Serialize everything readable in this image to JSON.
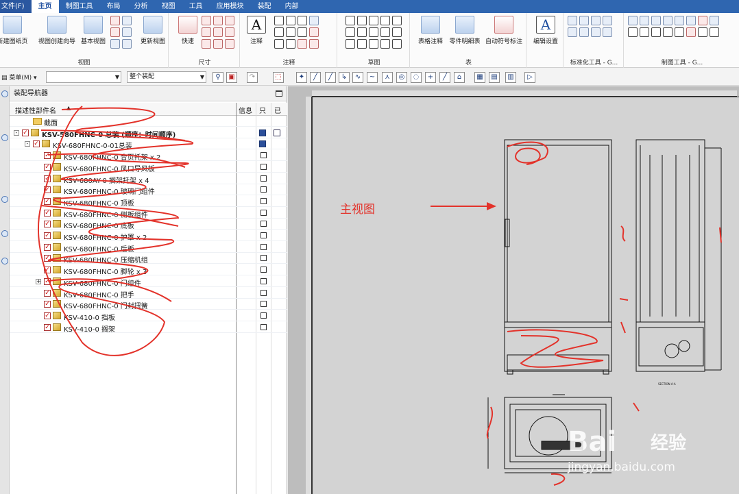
{
  "menu": {
    "file": "文件(F)",
    "tabs": [
      "主页",
      "制图工具",
      "布局",
      "分析",
      "视图",
      "工具",
      "应用模块",
      "装配",
      "内部"
    ]
  },
  "ribbon": {
    "groups": [
      {
        "label": "视图",
        "buttons": [
          "新建图纸页",
          "视图创建向导",
          "基本视图",
          "更新视图"
        ]
      },
      {
        "label": "尺寸",
        "buttons": [
          "快速"
        ]
      },
      {
        "label": "注释",
        "buttons": [
          "注释"
        ]
      },
      {
        "label": "草图",
        "buttons": []
      },
      {
        "label": "表",
        "buttons": [
          "表格注释",
          "零件明细表",
          "自动符号标注"
        ]
      },
      {
        "label": "",
        "buttons": [
          "编辑设置"
        ]
      },
      {
        "label": "标准化工具 - G...",
        "buttons": []
      },
      {
        "label": "制图工具 - G...",
        "buttons": []
      }
    ]
  },
  "toolbar": {
    "menu_label": "菜单(M)",
    "combo1": "",
    "combo2": "整个装配"
  },
  "navigator": {
    "title": "装配导航器",
    "columns": [
      "描述性部件名",
      "信息",
      "只",
      "已"
    ],
    "rows": [
      {
        "indent": 1,
        "type": "folder",
        "label": "截面"
      },
      {
        "indent": 0,
        "type": "assembly",
        "label": "KSV-580FHNC-0 总装 (顺序：时间顺序)",
        "bold": true,
        "expander": "-"
      },
      {
        "indent": 1,
        "type": "assembly",
        "label": "KSV-680FHNC-0-01总装",
        "expander": "-"
      },
      {
        "indent": 2,
        "type": "part",
        "label": "KSV-680FHNC-0 合页托架 x 2"
      },
      {
        "indent": 2,
        "type": "part",
        "label": "KSV-680FHNC-0 风口导风板"
      },
      {
        "indent": 2,
        "type": "part",
        "label": "KSV-680AY-0 搁架托架 x 4"
      },
      {
        "indent": 2,
        "type": "part",
        "label": "KSV-680FHNC-0 玻璃门组件"
      },
      {
        "indent": 2,
        "type": "part",
        "label": "KSV-680FHNC-0 顶板"
      },
      {
        "indent": 2,
        "type": "part",
        "label": "KSV-680FHNC-0 侧板组件"
      },
      {
        "indent": 2,
        "type": "part",
        "label": "KSV-680FHNC-0 底板"
      },
      {
        "indent": 2,
        "type": "part",
        "label": "KSV-680FHNC-0 护罩 x 2"
      },
      {
        "indent": 2,
        "type": "part",
        "label": "KSV-680FHNC-0 后板"
      },
      {
        "indent": 2,
        "type": "part",
        "label": "KSV-680FHNC-0 压缩机组"
      },
      {
        "indent": 2,
        "type": "part",
        "label": "KSV-680FHNC-0 脚轮 x 3"
      },
      {
        "indent": 2,
        "type": "assembly",
        "label": "KSV-680FHNC-0 门组件",
        "expander": "+"
      },
      {
        "indent": 2,
        "type": "part",
        "label": "KSV-680FHNC-0 把手"
      },
      {
        "indent": 2,
        "type": "part",
        "label": "KSV-680FHNC-0 门封扭簧"
      },
      {
        "indent": 2,
        "type": "part",
        "label": "KSV-410-0 挡板"
      },
      {
        "indent": 2,
        "type": "part",
        "label": "KSV-410-0 搁架"
      }
    ]
  },
  "drawing": {
    "annotation": "主视图",
    "section_label": "SECTION A-A",
    "watermark": {
      "brand": "Bai",
      "brand2": "经验",
      "url": "jingyan.baidu.com"
    }
  },
  "colors": {
    "accent": "#2f66b0",
    "scribble": "#e3322a",
    "canvas": "#bdbdbd"
  }
}
